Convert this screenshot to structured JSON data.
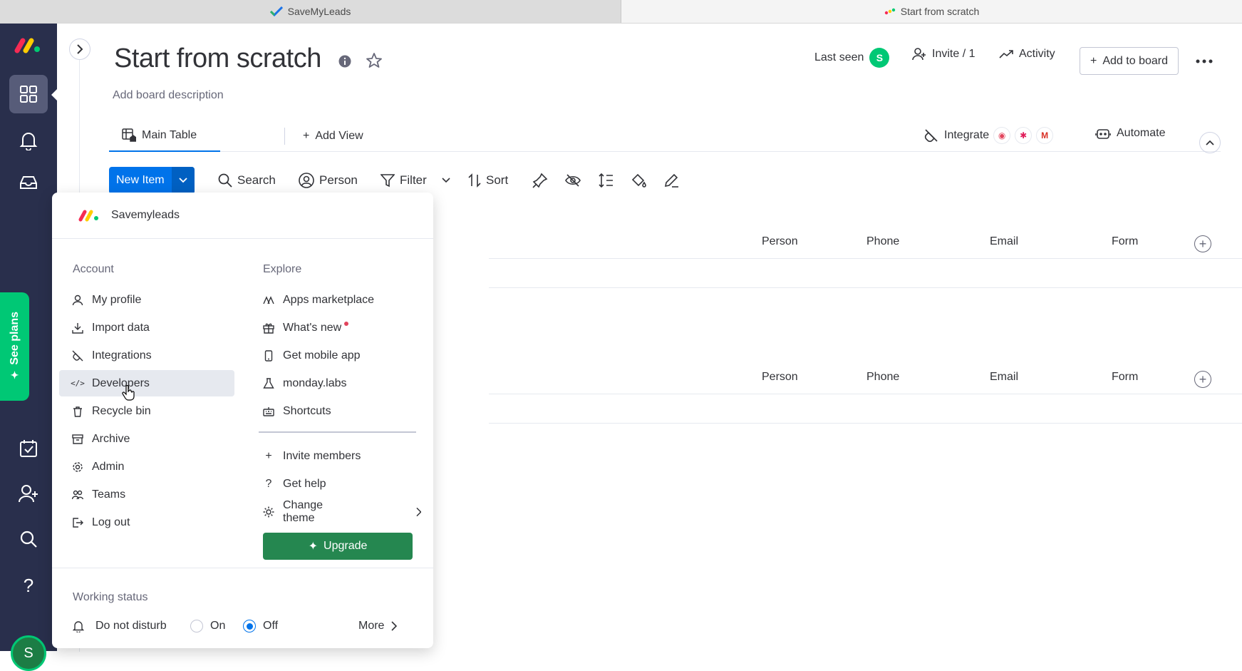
{
  "browser": {
    "tabs": [
      {
        "label": "SaveMyLeads",
        "icon": "savemyleads-check-icon"
      },
      {
        "label": "Start from scratch",
        "icon": "monday-logo-icon"
      }
    ]
  },
  "board": {
    "title": "Start from scratch",
    "description": "Add board description",
    "last_seen_label": "Last seen",
    "last_seen_avatar": "S",
    "invite_label": "Invite / 1",
    "activity_label": "Activity",
    "add_to_board_label": "Add to board"
  },
  "views": {
    "main_table": "Main Table",
    "add_view": "Add View",
    "integrate": "Integrate",
    "automate": "Automate"
  },
  "toolbar": {
    "new_item": "New Item",
    "search": "Search",
    "person": "Person",
    "filter": "Filter",
    "sort": "Sort"
  },
  "columns": {
    "group1": [
      "Person",
      "Phone",
      "Email",
      "Form"
    ],
    "group2": [
      "Person",
      "Phone",
      "Email",
      "Form"
    ]
  },
  "leftnav": {
    "see_plans": "See plans",
    "avatar": "S"
  },
  "menu": {
    "account_name": "Savemyleads",
    "account_header": "Account",
    "explore_header": "Explore",
    "account_items": [
      {
        "label": "My profile",
        "icon": "user-icon"
      },
      {
        "label": "Import data",
        "icon": "download-icon"
      },
      {
        "label": "Integrations",
        "icon": "plug-icon"
      },
      {
        "label": "Developers",
        "icon": "code-icon"
      },
      {
        "label": "Recycle bin",
        "icon": "trash-icon"
      },
      {
        "label": "Archive",
        "icon": "archive-icon"
      },
      {
        "label": "Admin",
        "icon": "gear-icon"
      },
      {
        "label": "Teams",
        "icon": "team-icon"
      },
      {
        "label": "Log out",
        "icon": "logout-icon"
      }
    ],
    "explore_items": [
      {
        "label": "Apps marketplace",
        "icon": "apps-icon"
      },
      {
        "label": "What's new",
        "icon": "gift-icon"
      },
      {
        "label": "Get mobile app",
        "icon": "mobile-icon"
      },
      {
        "label": "monday.labs",
        "icon": "flask-icon"
      },
      {
        "label": "Shortcuts",
        "icon": "keyboard-icon"
      }
    ],
    "explore_items_2": [
      {
        "label": "Invite members",
        "icon": "plus-icon"
      },
      {
        "label": "Get help",
        "icon": "question-icon"
      },
      {
        "label": "Change theme",
        "icon": "sun-icon"
      }
    ],
    "upgrade": "Upgrade",
    "working_status": "Working status",
    "do_not_disturb": "Do not disturb",
    "on": "On",
    "off": "Off",
    "more": "More"
  },
  "colors": {
    "nav_bg": "#292f4c",
    "primary": "#0073ea",
    "green": "#00c875",
    "upgrade_green": "#258750"
  }
}
